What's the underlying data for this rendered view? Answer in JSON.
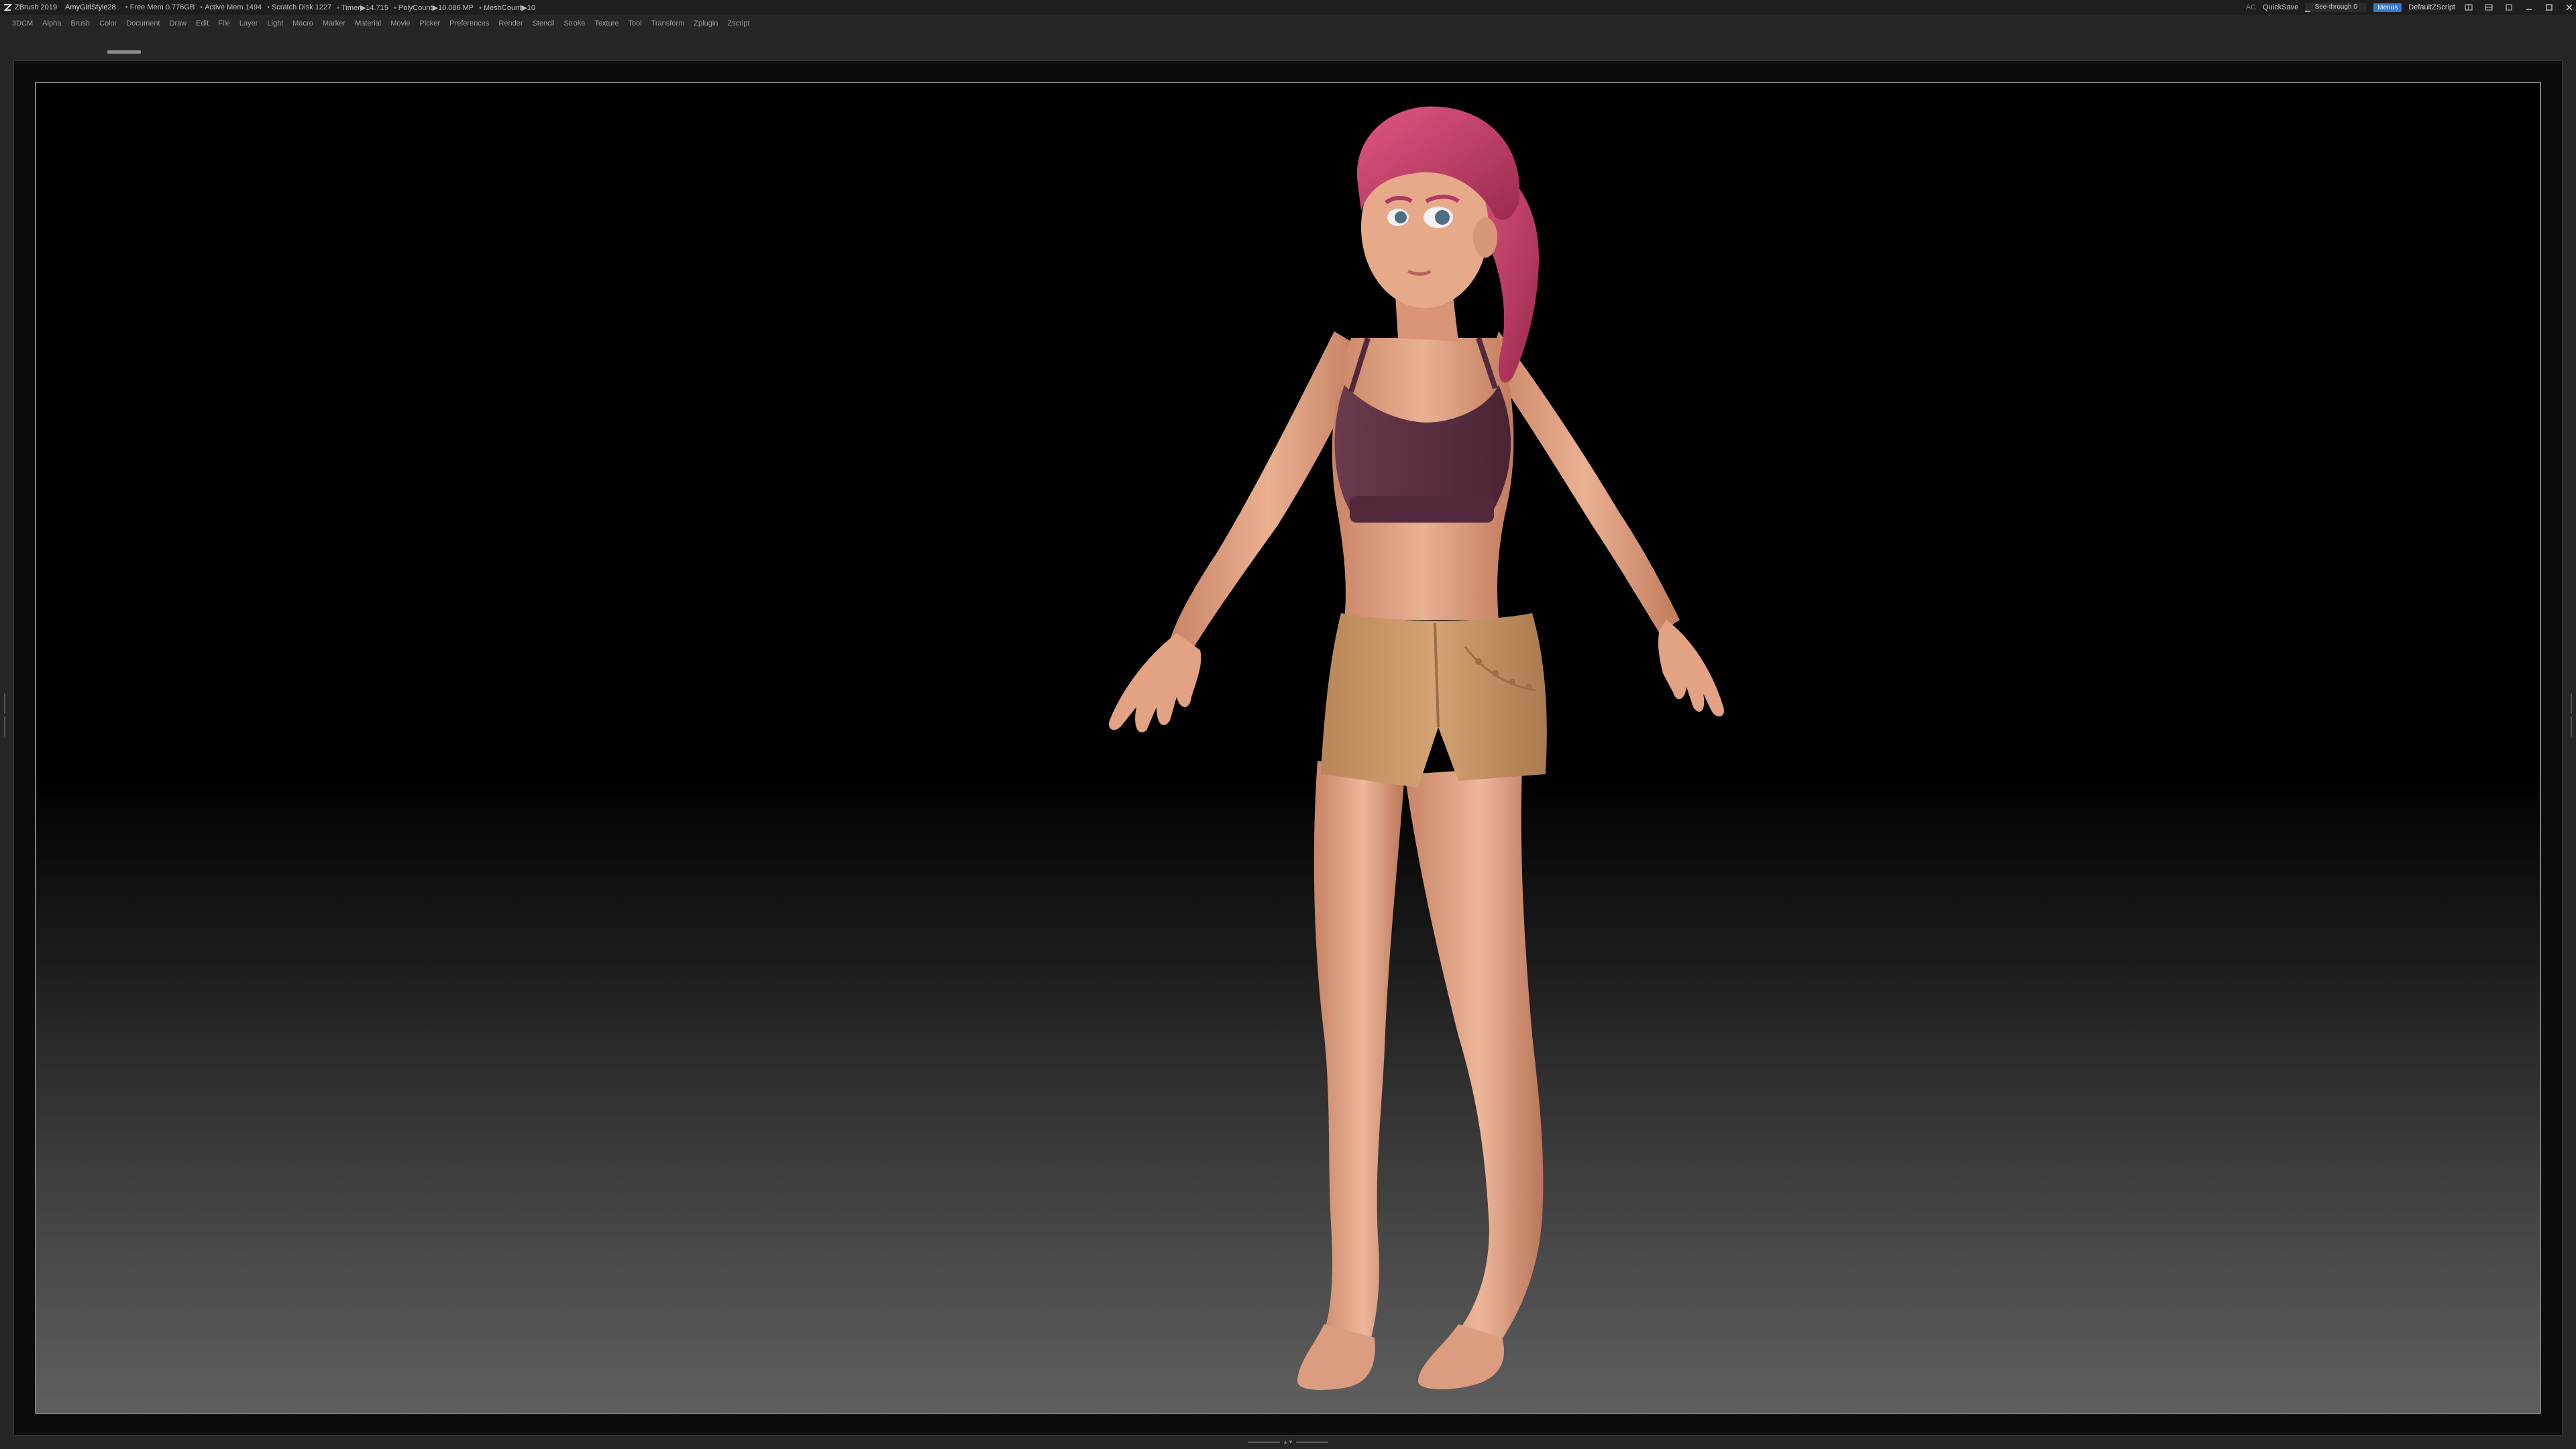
{
  "titlebar": {
    "app_title": "ZBrush 2019",
    "document_name": "AmyGirlStyle28",
    "stats": [
      {
        "label": "Free Mem 0.776GB"
      },
      {
        "label": "Active Mem 1494"
      },
      {
        "label": "Scratch Disk 1227"
      },
      {
        "label": "Timer▶14.715"
      },
      {
        "label": "PolyCount▶10.086 MP"
      },
      {
        "label": "MeshCount▶10"
      }
    ],
    "ac_label": "AC",
    "quicksave_label": "QuickSave",
    "see_through_label": "See-through   0",
    "see_through_value": 0,
    "menus_label": "Menus",
    "script_name": "DefaultZScript",
    "icons": [
      "layout-icon",
      "layout-icon",
      "layout-icon",
      "minimize-icon",
      "maximize-icon",
      "close-icon"
    ]
  },
  "menubar": {
    "items": [
      "3DCM",
      "Alpha",
      "Brush",
      "Color",
      "Document",
      "Draw",
      "Edit",
      "File",
      "Layer",
      "Light",
      "Macro",
      "Marker",
      "Material",
      "Movie",
      "Picker",
      "Preferences",
      "Render",
      "Stencil",
      "Stroke",
      "Texture",
      "Tool",
      "Transform",
      "Zplugin",
      "Zscript"
    ]
  },
  "colors": {
    "ui_bg": "#262626",
    "canvas_border": "#7d7d7d",
    "accent_blue": "#3b78c7",
    "accent_orange": "#e2a43a",
    "skin": "#e4a687",
    "hair": "#c23f6b",
    "top": "#5a2f40",
    "shorts": "#c69466"
  },
  "viewport": {
    "content": "3D sculpted female character model"
  }
}
